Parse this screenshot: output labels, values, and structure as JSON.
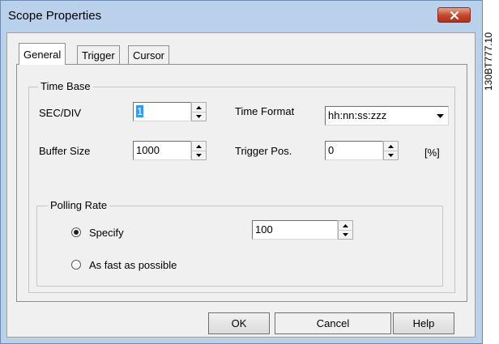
{
  "window": {
    "title": "Scope Properties"
  },
  "tabs": [
    {
      "label": "General",
      "active": true
    },
    {
      "label": "Trigger",
      "active": false
    },
    {
      "label": "Cursor",
      "active": false
    }
  ],
  "time_base": {
    "group_label": "Time Base",
    "sec_div": {
      "label": "SEC/DIV",
      "value": "1"
    },
    "buffer_size": {
      "label": "Buffer Size",
      "value": "1000"
    },
    "time_format": {
      "label": "Time Format",
      "value": "hh:nn:ss:zzz"
    },
    "trigger_pos": {
      "label": "Trigger Pos.",
      "value": "0",
      "unit": "[%]"
    }
  },
  "polling_rate": {
    "group_label": "Polling Rate",
    "specify": {
      "label": "Specify",
      "selected": true,
      "value": "100"
    },
    "as_fast": {
      "label": "As fast as possible",
      "selected": false
    }
  },
  "buttons": {
    "ok": "OK",
    "cancel": "Cancel",
    "help": "Help"
  },
  "side_code": "130BT777.10",
  "colors": {
    "title_bar": "#b9d1ea",
    "close_button": "#c7432a",
    "selection": "#3399ff"
  }
}
